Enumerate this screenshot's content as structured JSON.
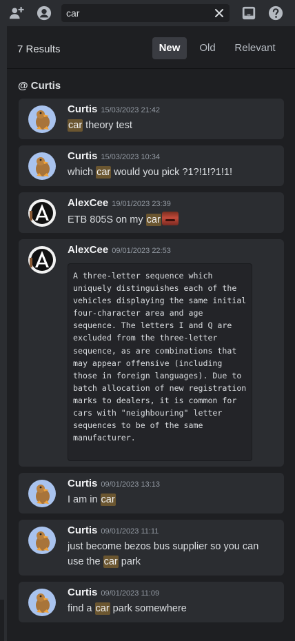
{
  "search": {
    "value": "car"
  },
  "results": {
    "count_label": "7 Results",
    "sort_tabs": [
      "New",
      "Old",
      "Relevant"
    ],
    "active_tab": "New"
  },
  "channel": {
    "label": "@ Curtis"
  },
  "messages": [
    {
      "author": "Curtis",
      "timestamp": "15/03/2023 21:42",
      "before": "",
      "match": "car",
      "after": " theory test"
    },
    {
      "author": "Curtis",
      "timestamp": "15/03/2023 10:34",
      "before": "which ",
      "match": "car",
      "after": " would you pick ?1?!1!?1!1!"
    },
    {
      "author": "AlexCee",
      "timestamp": "19/01/2023 23:39",
      "before": "ETB 805S on my ",
      "match": "car",
      "after": ""
    },
    {
      "author": "AlexCee",
      "timestamp": "09/01/2023 22:53",
      "code": "A three-letter sequence which uniquely distinguishes each of the vehicles displaying the same initial four-character area and age sequence. The letters I and Q are excluded from the three-letter sequence, as are combinations that may appear offensive (including those in foreign languages). Due to batch allocation of new registration marks to dealers, it is common for cars with \"neighbouring\" letter sequences to be of the same manufacturer."
    },
    {
      "author": "Curtis",
      "timestamp": "09/01/2023 13:13",
      "before": "I am in ",
      "match": "car",
      "after": ""
    },
    {
      "author": "Curtis",
      "timestamp": "09/01/2023 11:11",
      "before": "just become bezos bus supplier so you can use the ",
      "match": "car",
      "after": " park"
    },
    {
      "author": "Curtis",
      "timestamp": "09/01/2023 11:09",
      "before": "find a ",
      "match": "car",
      "after": " park somewhere"
    }
  ],
  "icons": {
    "add_friend": "add-friend-icon",
    "profile": "user-profile-icon",
    "clear": "close-icon",
    "inbox": "inbox-icon",
    "help": "help-icon",
    "avatar_curtis": "duck-avatar",
    "avatar_alexcee": "linkin-park-logo-avatar",
    "emoji": "face-emoji"
  },
  "colors": {
    "highlight": "#6b5630",
    "background": "#1e1f22",
    "card": "#2b2d31"
  }
}
